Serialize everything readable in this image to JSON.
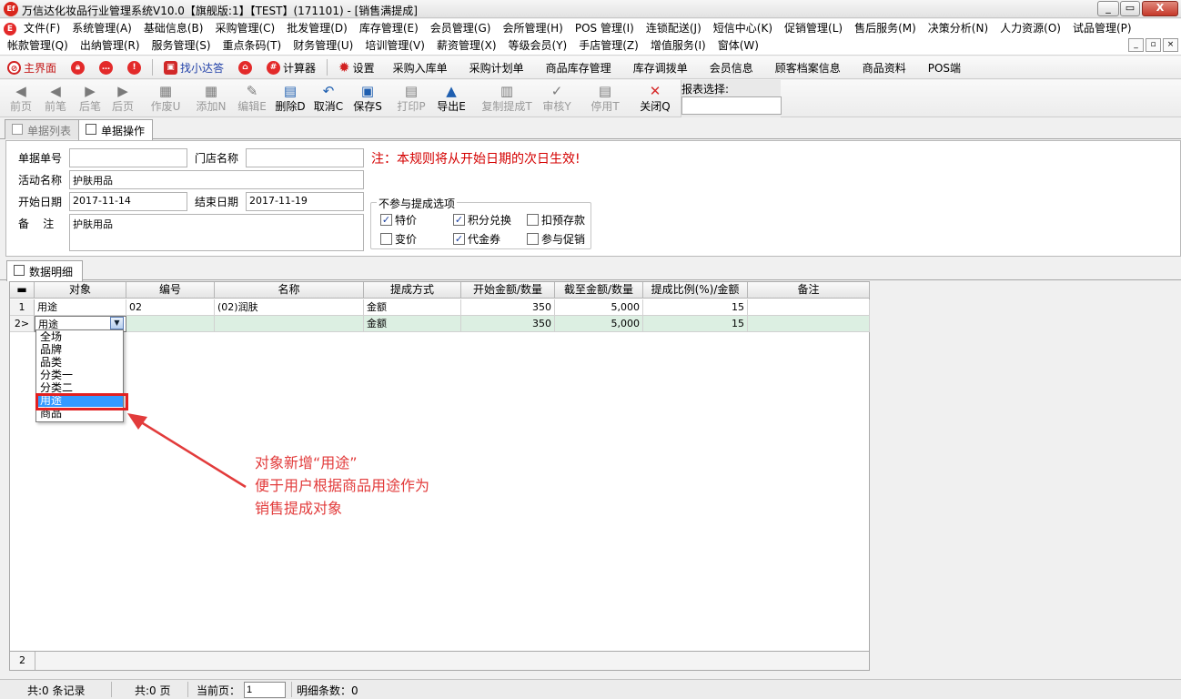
{
  "window": {
    "title": "万信达化妆品行业管理系统V10.0【旗舰版:1】【TEST】(171101) - [销售满提成]",
    "logo": "Ef",
    "minimize": "_",
    "restore": "▭",
    "close": "X"
  },
  "menu": {
    "row1": [
      "文件(F)",
      "系统管理(A)",
      "基础信息(B)",
      "采购管理(C)",
      "批发管理(D)",
      "库存管理(E)",
      "会员管理(G)",
      "会所管理(H)",
      "POS 管理(I)",
      "连锁配送(J)",
      "短信中心(K)",
      "促销管理(L)",
      "售后服务(M)",
      "决策分析(N)",
      "人力资源(O)",
      "试品管理(P)"
    ],
    "row2": [
      "帐款管理(Q)",
      "出纳管理(R)",
      "服务管理(S)",
      "重点条码(T)",
      "财务管理(U)",
      "培训管理(V)",
      "薪资管理(X)",
      "等级会员(Y)",
      "手店管理(Z)",
      "增值服务(I)",
      "窗体(W)"
    ],
    "mdi": [
      "_",
      "▫",
      "×"
    ]
  },
  "quickbar": {
    "main": "主界面",
    "assistant": "找小达答",
    "calculator": "计算器",
    "settings": "设置",
    "links": [
      "采购入库单",
      "采购计划单",
      "商品库存管理",
      "库存调拨单",
      "会员信息",
      "顾客档案信息",
      "商品资料",
      "POS端"
    ]
  },
  "toolbar": {
    "buttons": [
      "前页",
      "前笔",
      "后笔",
      "后页",
      "作废U",
      "添加N",
      "编辑E",
      "删除D",
      "取消C",
      "保存S",
      "打印P",
      "导出E",
      "复制提成T",
      "审核Y",
      "停用T",
      "关闭Q"
    ],
    "report_label": "报表选择:"
  },
  "tabs": {
    "list": "单据列表",
    "operate": "单据操作",
    "detail": "数据明细"
  },
  "form": {
    "doc_no_label": "单据单号",
    "doc_no": "",
    "store_label": "门店名称",
    "store": "",
    "notice": "注：本规则将从开始日期的次日生效!",
    "activity_label": "活动名称",
    "activity": "护肤用品",
    "start_label": "开始日期",
    "start": "2017-11-14",
    "end_label": "结束日期",
    "end": "2017-11-19",
    "remark_label": "备    注",
    "remark": "护肤用品",
    "options_title": "不参与提成选项",
    "options": [
      {
        "label": "特价",
        "checked": true
      },
      {
        "label": "积分兑换",
        "checked": true
      },
      {
        "label": "扣预存款",
        "checked": false
      },
      {
        "label": "变价",
        "checked": false
      },
      {
        "label": "代金券",
        "checked": true
      },
      {
        "label": "参与促销",
        "checked": false
      }
    ]
  },
  "grid": {
    "columns": [
      "对象",
      "编号",
      "名称",
      "提成方式",
      "开始金额/数量",
      "截至金额/数量",
      "提成比例(%)/金额",
      "备注"
    ],
    "rows": [
      {
        "no": "1",
        "obj": "用途",
        "code": "02",
        "name": "(02)润肤",
        "mode": "金额",
        "start": "350",
        "end": "5,000",
        "rate": "15",
        "remark": ""
      },
      {
        "no": "2>",
        "obj": "用途",
        "code": "",
        "name": "",
        "mode": "金额",
        "start": "350",
        "end": "5,000",
        "rate": "15",
        "remark": ""
      }
    ],
    "dropdown": [
      "全场",
      "品牌",
      "品类",
      "分类一",
      "分类二",
      "用途",
      "商品"
    ],
    "dropdown_selected": "用途",
    "footer_count": "2"
  },
  "annotation": [
    "对象新增“用途”",
    "便于用户根据商品用途作为",
    "销售提成对象"
  ],
  "status": {
    "records": "共:0 条记录",
    "pages": "共:0 页",
    "current_label": "当前页：",
    "current": "1",
    "detail": "明细条数：0"
  }
}
